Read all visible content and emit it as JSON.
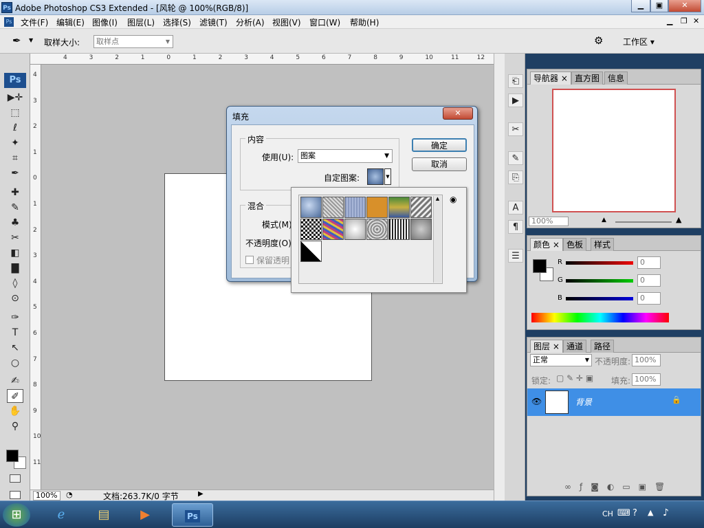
{
  "window": {
    "title": "Adobe Photoshop CS3 Extended - [风轮 @ 100%(RGB/8)]",
    "min": "▁",
    "max": "▣",
    "close": "✕"
  },
  "menu": [
    "文件(F)",
    "编辑(E)",
    "图像(I)",
    "图层(L)",
    "选择(S)",
    "滤镜(T)",
    "分析(A)",
    "视图(V)",
    "窗口(W)",
    "帮助(H)"
  ],
  "options": {
    "label": "取样大小:",
    "select_value": "取样点",
    "workspace": "工作区 ▾"
  },
  "tools": [
    "▶✛",
    "⬚",
    "ℓ",
    "✦",
    "⌗",
    "✒",
    "✚",
    "✎",
    "♣",
    "✂",
    "◧",
    "▇",
    "◊",
    "⊙",
    "✑",
    "T",
    "↖",
    "○",
    "✍",
    "✐",
    "✋",
    "⚲"
  ],
  "ruler_top": [
    "4",
    "3",
    "2",
    "1",
    "0",
    "1",
    "2",
    "3",
    "4",
    "5",
    "6",
    "7",
    "8",
    "9",
    "10",
    "11",
    "12"
  ],
  "ruler_left": [
    "4",
    "3",
    "2",
    "1",
    "0",
    "1",
    "2",
    "3",
    "4",
    "5",
    "6",
    "7",
    "8",
    "9",
    "10",
    "11"
  ],
  "status": {
    "zoom": "100%",
    "doc": "文档:263.7K/0 字节"
  },
  "navigator": {
    "tabs": [
      "导航器 ×",
      "直方图",
      "信息"
    ],
    "zoom": "100%"
  },
  "color": {
    "tabs": [
      "颜色 ×",
      "色板",
      "样式"
    ],
    "R": "0",
    "G": "0",
    "B": "0",
    "r_label": "R",
    "g_label": "G",
    "b_label": "B"
  },
  "layers": {
    "tabs": [
      "图层 ×",
      "通道",
      "路径"
    ],
    "mode": "正常",
    "opacity_label": "不透明度:",
    "opacity": "100%",
    "lock_label": "锁定:",
    "fill_label": "填充:",
    "fill": "100%",
    "layer_name": "背景"
  },
  "dialog": {
    "title": "填充",
    "content_legend": "内容",
    "use_label": "使用(U):",
    "use_value": "图案",
    "custom_label": "自定图案:",
    "blend_legend": "混合",
    "mode_label": "模式(M)",
    "opacity_label": "不透明度(O)",
    "preserve_label": "保留透明",
    "ok": "确定",
    "cancel": "取消"
  },
  "taskbar": {
    "lang": "CH"
  }
}
